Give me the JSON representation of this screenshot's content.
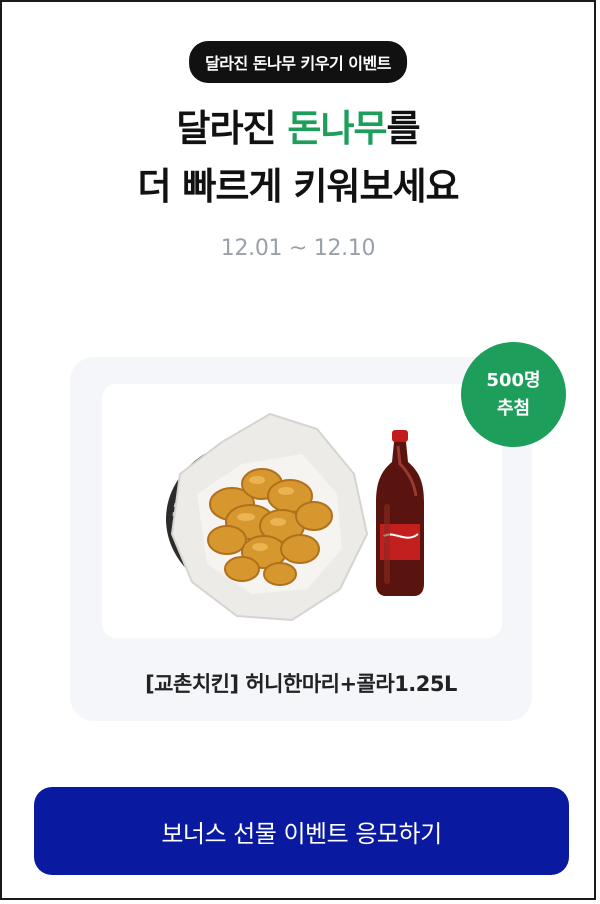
{
  "event": {
    "pill_label": "달라진 돈나무 키우기 이벤트",
    "headline_part1": "달라진 ",
    "headline_accent": "돈나무",
    "headline_part2": "를",
    "headline_line2": "더 빠르게 키워보세요",
    "period": "12.01 ~ 12.10"
  },
  "prize": {
    "badge_count": "500명",
    "badge_label": "추첨",
    "image_icon": "fried-chicken-and-cola-image",
    "name": "[교촌치킨] 허니한마리+콜라1.25L"
  },
  "cta": {
    "label": "보너스 선물 이벤트 응모하기"
  },
  "colors": {
    "accent_green": "#1e9e5b",
    "cta_blue": "#0a1aa0",
    "pill_black": "#111111"
  }
}
